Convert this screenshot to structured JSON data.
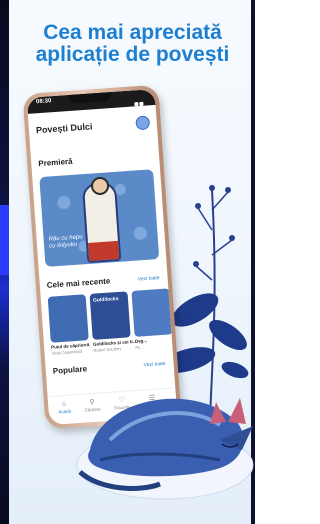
{
  "colors": {
    "headline": "#1e7fd0",
    "accent": "#1e7fd0",
    "fox_blue": "#3a5fb0",
    "page_bg": "#eef5fc"
  },
  "headline": {
    "line1": "Cea mai apreciată",
    "line2": "aplicație de povești"
  },
  "phone": {
    "status_time": "08:30",
    "app_title": "Povești Dulci",
    "profile_icon": "avatar-icon",
    "featured": {
      "title": "Premieră",
      "caption_line1": "Rău cu hepu",
      "caption_line2": "cu ilolyuku"
    },
    "recent": {
      "title": "Cele mai recente",
      "see_all": "Vezi toate",
      "cards": [
        {
          "title": "Puiul de căpriorră",
          "author": "Virgil Caramosod"
        },
        {
          "title": "Goldilocks și cei tr...",
          "author": "Robert Southey",
          "cover_label": "Goldilocks"
        },
        {
          "title": "Deg...",
          "author": "Pu..."
        }
      ]
    },
    "popular": {
      "title": "Populare",
      "see_all": "Vezi toate"
    },
    "tabs": [
      {
        "label": "Acasă",
        "icon": "home-icon"
      },
      {
        "label": "Căutare",
        "icon": "search-icon"
      },
      {
        "label": "Favorite",
        "icon": "heart-icon"
      },
      {
        "label": "Meniu",
        "icon": "menu-icon"
      }
    ]
  }
}
